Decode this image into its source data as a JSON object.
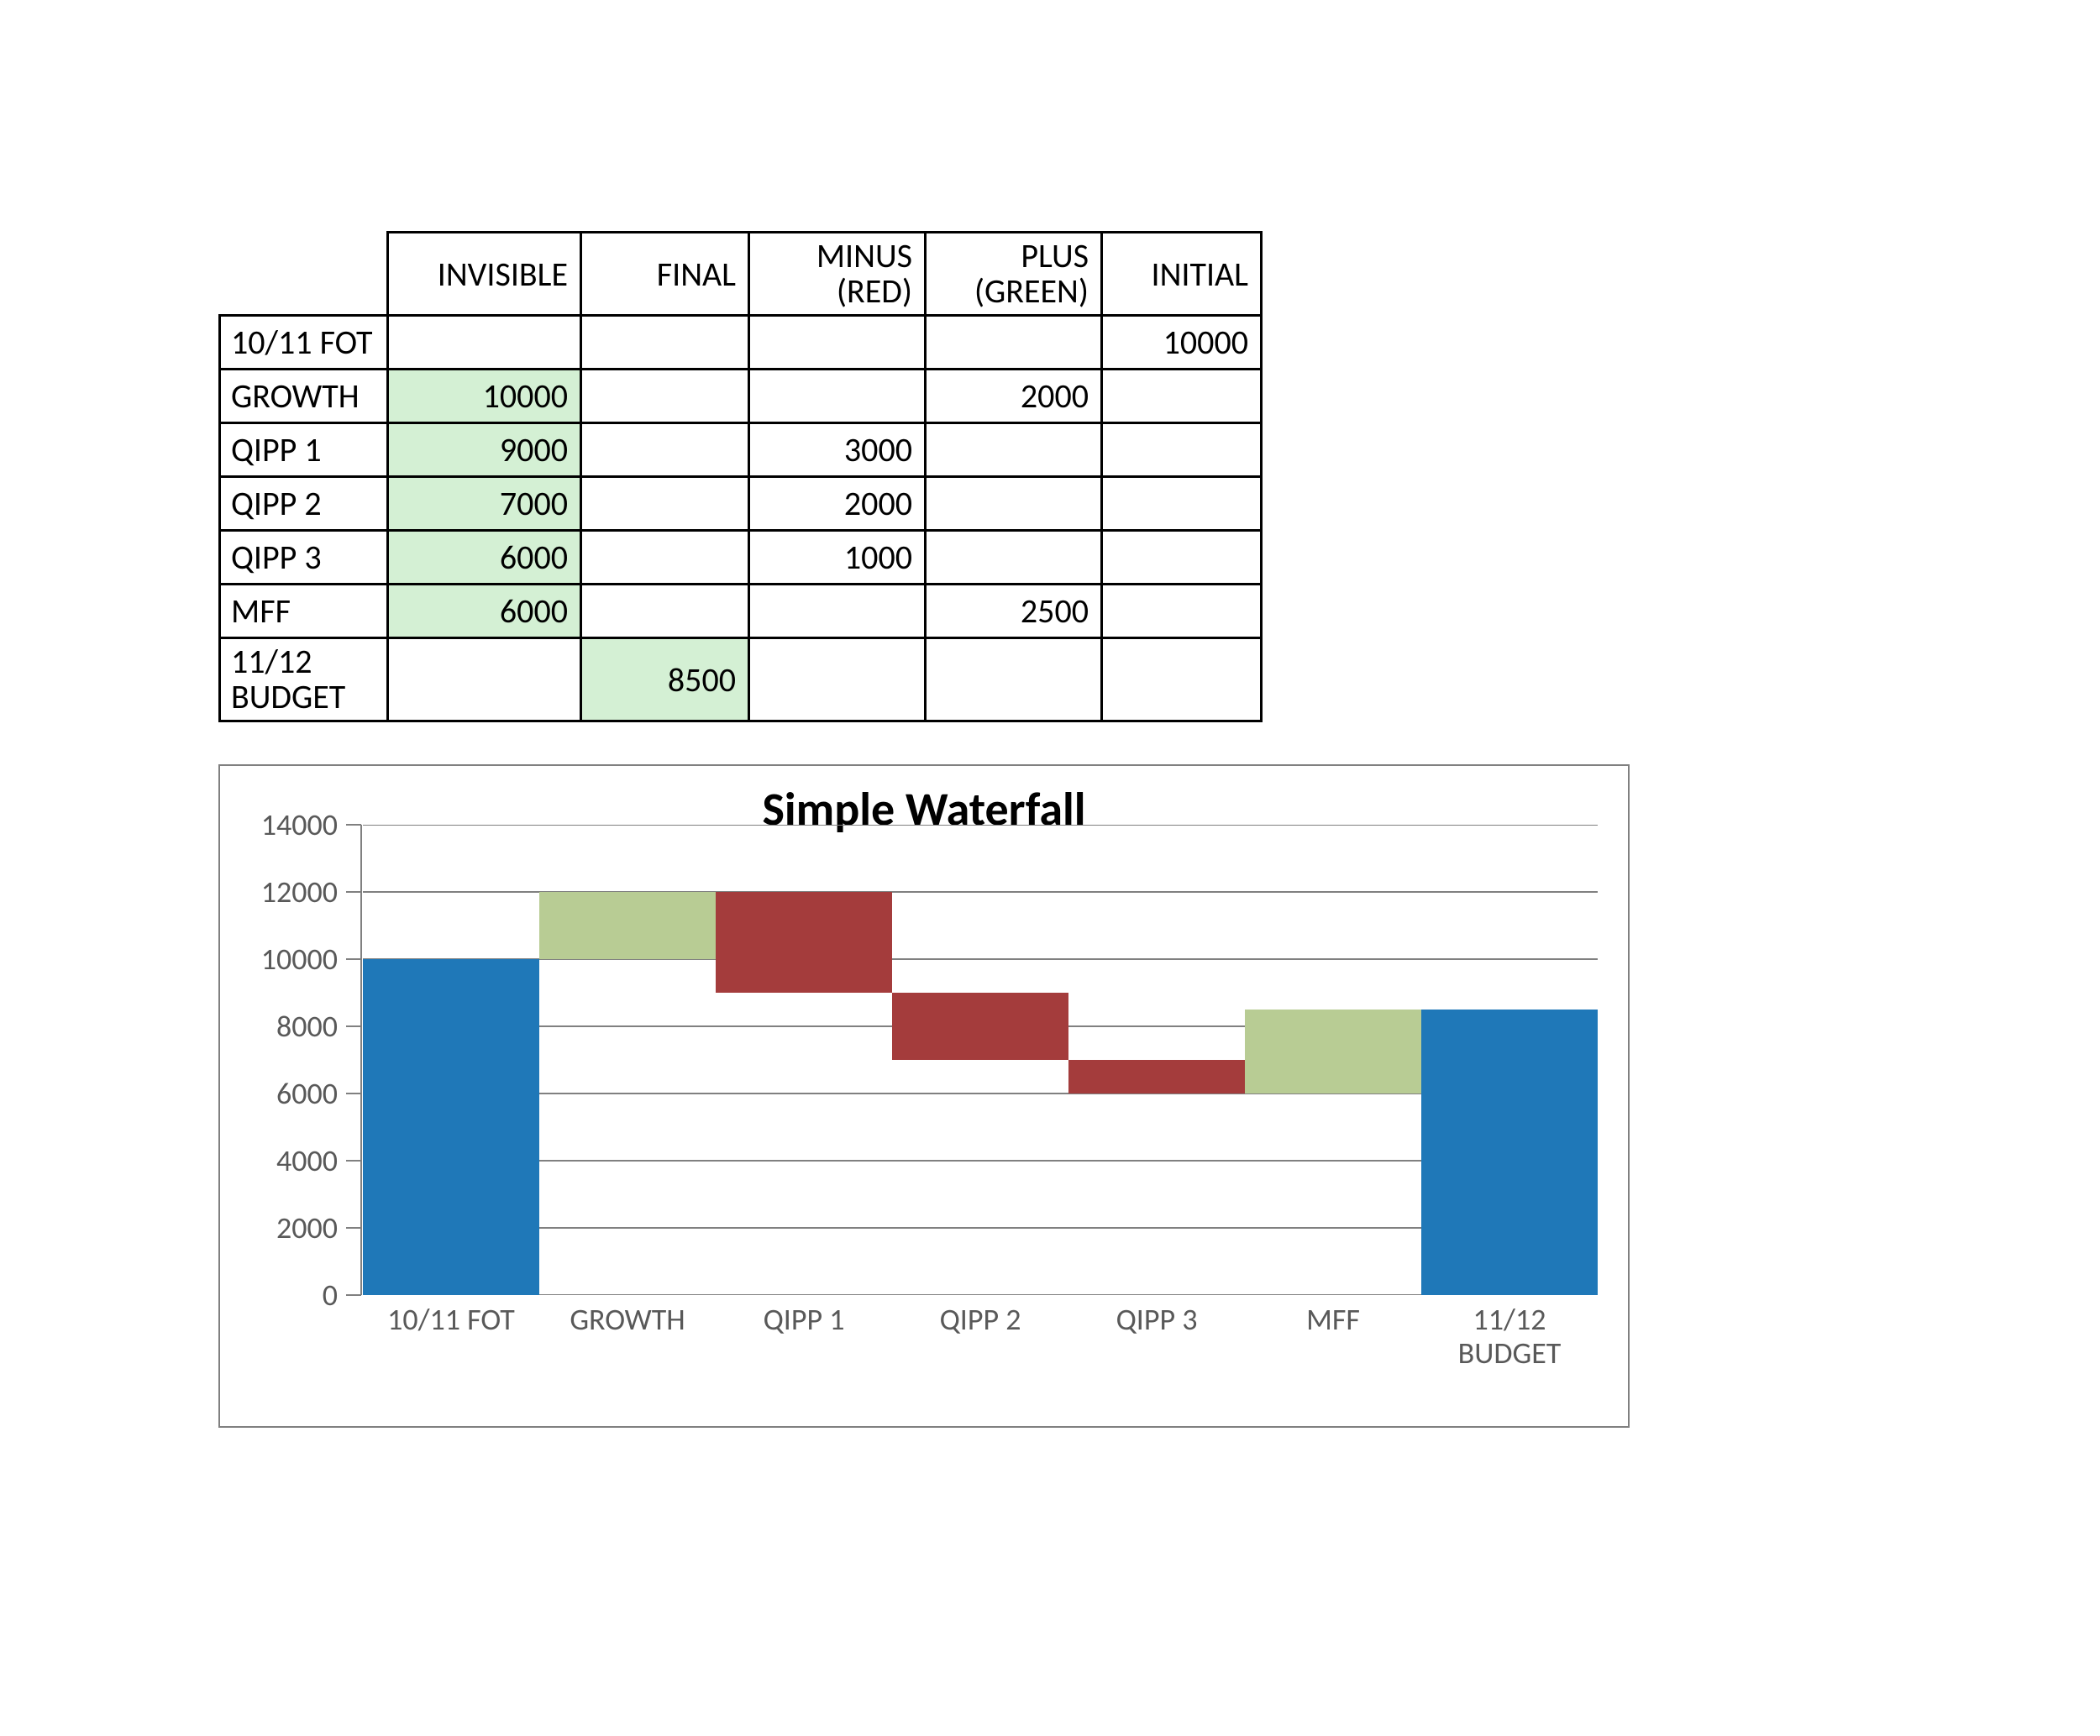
{
  "table": {
    "headers": {
      "invisible": "INVISIBLE",
      "final": "FINAL",
      "minus": "MINUS (RED)",
      "plus": "PLUS (GREEN)",
      "initial": "INITIAL"
    },
    "rows": [
      {
        "label": "10/11 FOT",
        "invisible": "",
        "final": "",
        "minus": "",
        "plus": "",
        "initial": "10000",
        "hl_inv": false,
        "hl_fin": false
      },
      {
        "label": "GROWTH",
        "invisible": "10000",
        "final": "",
        "minus": "",
        "plus": "2000",
        "initial": "",
        "hl_inv": true,
        "hl_fin": false
      },
      {
        "label": "QIPP 1",
        "invisible": "9000",
        "final": "",
        "minus": "3000",
        "plus": "",
        "initial": "",
        "hl_inv": true,
        "hl_fin": false
      },
      {
        "label": "QIPP 2",
        "invisible": "7000",
        "final": "",
        "minus": "2000",
        "plus": "",
        "initial": "",
        "hl_inv": true,
        "hl_fin": false
      },
      {
        "label": "QIPP 3",
        "invisible": "6000",
        "final": "",
        "minus": "1000",
        "plus": "",
        "initial": "",
        "hl_inv": true,
        "hl_fin": false
      },
      {
        "label": "MFF",
        "invisible": "6000",
        "final": "",
        "minus": "",
        "plus": "2500",
        "initial": "",
        "hl_inv": true,
        "hl_fin": false
      },
      {
        "label": "11/12 BUDGET",
        "invisible": "",
        "final": "8500",
        "minus": "",
        "plus": "",
        "initial": "",
        "hl_inv": false,
        "hl_fin": true
      }
    ]
  },
  "chart_data": {
    "type": "bar",
    "title": "Simple Waterfall",
    "xlabel": "",
    "ylabel": "",
    "ylim": [
      0,
      14000
    ],
    "yticks": [
      0,
      2000,
      4000,
      6000,
      8000,
      10000,
      12000,
      14000
    ],
    "categories": [
      "10/11 FOT",
      "GROWTH",
      "QIPP 1",
      "QIPP 2",
      "QIPP 3",
      "MFF",
      "11/12 BUDGET"
    ],
    "series": [
      {
        "name": "INVISIBLE",
        "color": "transparent",
        "values": [
          0,
          10000,
          9000,
          7000,
          6000,
          6000,
          0
        ]
      },
      {
        "name": "INITIAL",
        "color": "#1f78b8",
        "values": [
          10000,
          0,
          0,
          0,
          0,
          0,
          0
        ]
      },
      {
        "name": "PLUS",
        "color": "#b8cc94",
        "values": [
          0,
          2000,
          0,
          0,
          0,
          2500,
          0
        ]
      },
      {
        "name": "MINUS",
        "color": "#a43c3c",
        "values": [
          0,
          0,
          3000,
          2000,
          1000,
          0,
          0
        ]
      },
      {
        "name": "FINAL",
        "color": "#1f78b8",
        "values": [
          0,
          0,
          0,
          0,
          0,
          0,
          8500
        ]
      }
    ],
    "colors": {
      "initial": "#1f78b8",
      "final": "#1f78b8",
      "plus": "#b8cc94",
      "minus": "#a43c3c"
    }
  }
}
